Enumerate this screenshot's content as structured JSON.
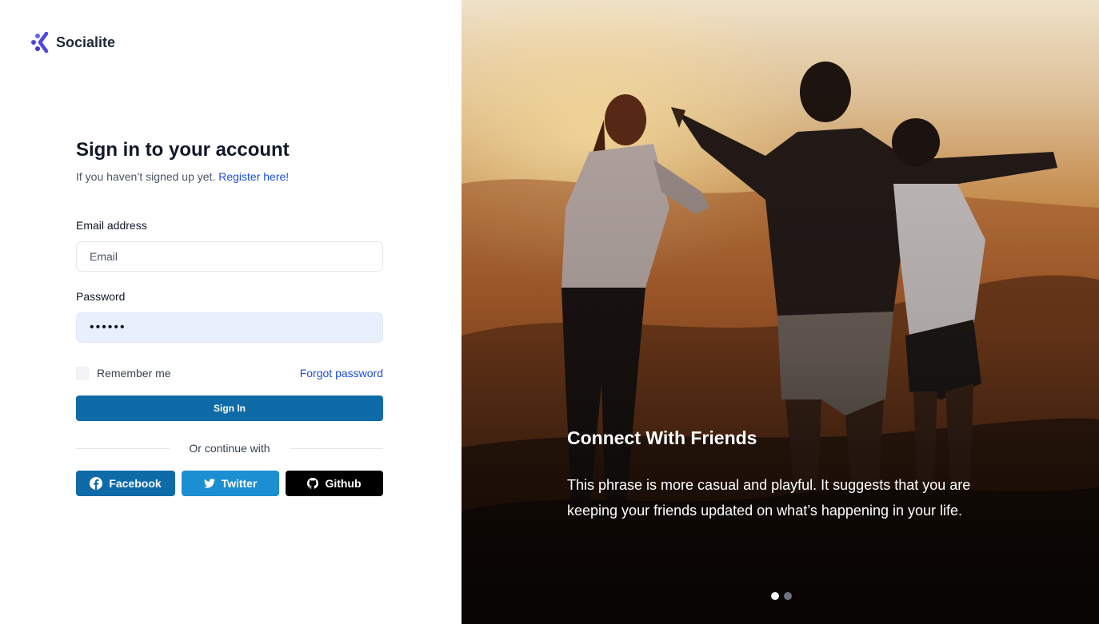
{
  "brand": {
    "name": "Socialite"
  },
  "signin": {
    "title": "Sign in to your account",
    "subtitle": "If you haven’t signed up yet.",
    "register_link": "Register here!",
    "email_label": "Email address",
    "email_placeholder": "Email",
    "password_label": "Password",
    "password_value": "••••••",
    "remember_label": "Remember me",
    "remember_checked": false,
    "forgot_link": "Forgot password",
    "submit_label": "Sign In",
    "divider_text": "Or continue with"
  },
  "social": [
    {
      "label": "Facebook",
      "icon": "facebook-icon",
      "color": "#0f6aa8"
    },
    {
      "label": "Twitter",
      "icon": "twitter-icon",
      "color": "#1b8fd2"
    },
    {
      "label": "Github",
      "icon": "github-icon",
      "color": "#000000"
    }
  ],
  "hero": {
    "title": "Connect With Friends",
    "text": "This phrase is more casual and playful. It suggests that you are keeping your friends updated on what’s happening in your life.",
    "slides_total": 2,
    "active_slide": 1
  },
  "colors": {
    "primary": "#0e6ba8",
    "link": "#1d4ed8",
    "logo": "#4f46e5"
  }
}
